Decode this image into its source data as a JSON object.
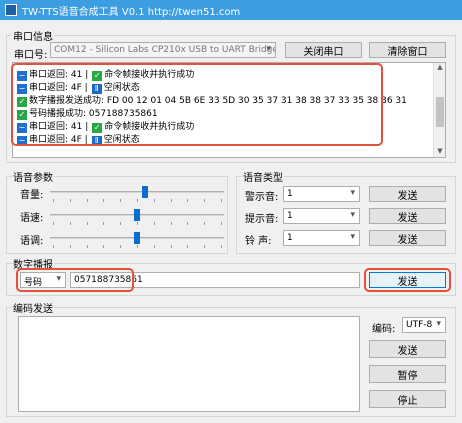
{
  "window": {
    "title": "TW-TTS语音合成工具 V0.1    http://twen51.com"
  },
  "serial": {
    "group_title": "串口信息",
    "port_label": "串口号:",
    "port_value": "COM12 - Silicon Labs CP210x USB to UART Bridge (",
    "close_button": "关闭串口",
    "clear_button": "清除窗口"
  },
  "log": {
    "lines": [
      {
        "icon": "minus-icon",
        "text": "串口返回: 41  |",
        "status_icon": "check-icon",
        "status": "命令帧接收并执行成功"
      },
      {
        "icon": "minus-icon",
        "text": "串口返回: 4F  |",
        "status_icon": "pause-icon",
        "status": "空闲状态"
      },
      {
        "icon": "check-icon",
        "text": "数字播报发送成功: FD 00 12 01 04 5B 6E 33 5D 30 35 37 31 38 38 37 33 35 38 36 31",
        "status_icon": "",
        "status": ""
      },
      {
        "icon": "check-icon",
        "text": "号码播报成功: 057188735861",
        "status_icon": "",
        "status": ""
      },
      {
        "icon": "minus-icon",
        "text": "串口返回: 41  |",
        "status_icon": "check-icon",
        "status": "命令帧接收并执行成功"
      },
      {
        "icon": "minus-icon",
        "text": "串口返回: 4F  |",
        "status_icon": "pause-icon",
        "status": "空闲状态"
      }
    ]
  },
  "voice_params": {
    "group_title": "语音参数",
    "volume_label": "音量:",
    "volume_level": 0.55,
    "speed_label": "语速:",
    "speed_level": 0.5,
    "pitch_label": "语调:",
    "pitch_level": 0.5
  },
  "voice_type": {
    "group_title": "语音类型",
    "prompt_label": "警示音:",
    "prompt_value": "1",
    "hint_label": "提示音:",
    "hint_value": "1",
    "bell_label": "铃  声:",
    "bell_value": "1",
    "send_label": "发送"
  },
  "digital": {
    "group_title": "数字播报",
    "mode_value": "号码",
    "number_value": "057188735861",
    "send_label": "发送"
  },
  "encode": {
    "group_title": "编码发送",
    "encoding_label": "编码:",
    "encoding_value": "UTF-8",
    "send_label": "发送",
    "pause_label": "暂停",
    "stop_label": "停止"
  },
  "colors": {
    "accent": "#3c9de1",
    "highlight": "#e0533a",
    "slider": "#0a6fcc"
  }
}
